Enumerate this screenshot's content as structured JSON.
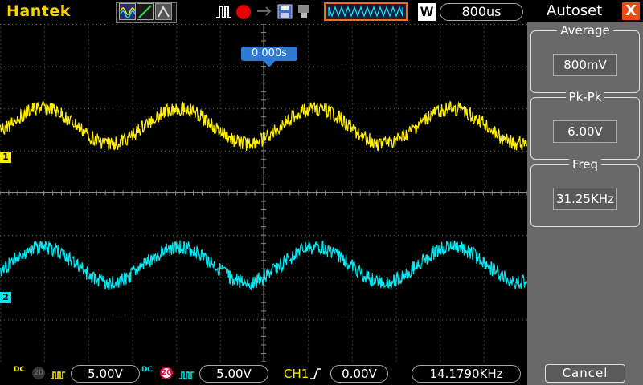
{
  "brand": "Hantek",
  "toolbar": {
    "window_mode": "W",
    "timebase": "800us",
    "icons": [
      "wave-sine-icon",
      "wave-ramp-icon",
      "wave-gray-icon",
      "pulse-icon",
      "record-icon",
      "arrow-icon",
      "save-icon",
      "usb-icon",
      "timebar-icon"
    ]
  },
  "screen": {
    "trigger_time": "0.000s",
    "ch1_marker": "1",
    "ch2_marker": "2"
  },
  "bottom": {
    "ch1_volts": "5.00V",
    "ch2_volts": "5.00V",
    "ch1_coupling": "DC",
    "ch2_coupling": "DC",
    "ch1_bw": "20",
    "ch2_bw": "20",
    "trig_source": "CH1",
    "trig_level": "0.00V",
    "frequency": "14.1790KHz"
  },
  "panel": {
    "title": "Autoset",
    "close": "X",
    "average_label": "Average",
    "average_value": "800mV",
    "pkpk_label": "Pk-Pk",
    "pkpk_value": "6.00V",
    "freq_label": "Freq",
    "freq_value": "31.25KHz",
    "cancel": "Cancel"
  },
  "colors": {
    "ch1": "#ffef00",
    "ch2": "#00e9f2",
    "brand": "#f5d400",
    "accent": "#2e78d6",
    "panel_bg": "#696969"
  }
}
